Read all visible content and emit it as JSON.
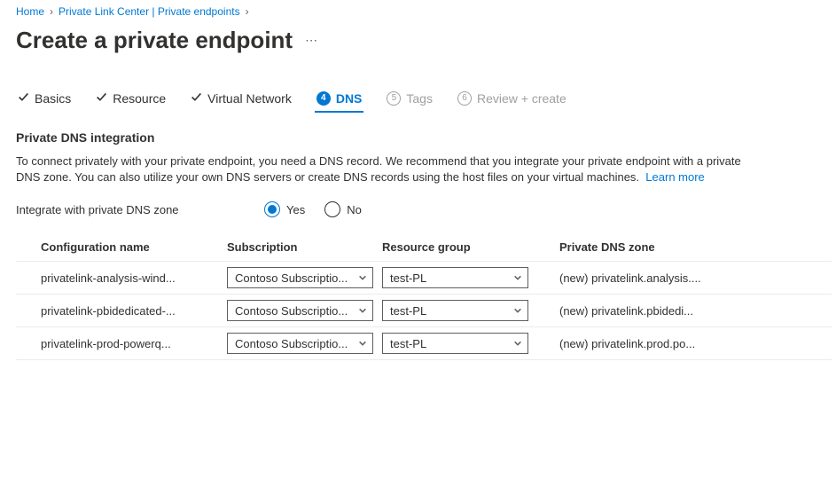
{
  "breadcrumb": {
    "items": [
      {
        "label": "Home"
      },
      {
        "label": "Private Link Center | Private endpoints"
      }
    ]
  },
  "page": {
    "title": "Create a private endpoint"
  },
  "tabs": [
    {
      "label": "Basics",
      "state": "done"
    },
    {
      "label": "Resource",
      "state": "done"
    },
    {
      "label": "Virtual Network",
      "state": "done"
    },
    {
      "label": "DNS",
      "state": "active",
      "step": "4"
    },
    {
      "label": "Tags",
      "state": "disabled",
      "step": "5"
    },
    {
      "label": "Review + create",
      "state": "disabled",
      "step": "6"
    }
  ],
  "section": {
    "header": "Private DNS integration",
    "description": "To connect privately with your private endpoint, you need a DNS record. We recommend that you integrate your private endpoint with a private DNS zone. You can also utilize your own DNS servers or create DNS records using the host files on your virtual machines.",
    "learn_more": "Learn more"
  },
  "form": {
    "integrate_label": "Integrate with private DNS zone",
    "yes": "Yes",
    "no": "No",
    "selected": "yes"
  },
  "table": {
    "headers": {
      "config": "Configuration name",
      "subscription": "Subscription",
      "resource_group": "Resource group",
      "dns_zone": "Private DNS zone"
    },
    "rows": [
      {
        "config": "privatelink-analysis-wind...",
        "subscription": "Contoso Subscriptio...",
        "resource_group": "test-PL",
        "dns_zone": "(new) privatelink.analysis...."
      },
      {
        "config": "privatelink-pbidedicated-...",
        "subscription": "Contoso Subscriptio...",
        "resource_group": "test-PL",
        "dns_zone": "(new) privatelink.pbidedi..."
      },
      {
        "config": "privatelink-prod-powerq...",
        "subscription": "Contoso Subscriptio...",
        "resource_group": "test-PL",
        "dns_zone": "(new) privatelink.prod.po..."
      }
    ]
  }
}
